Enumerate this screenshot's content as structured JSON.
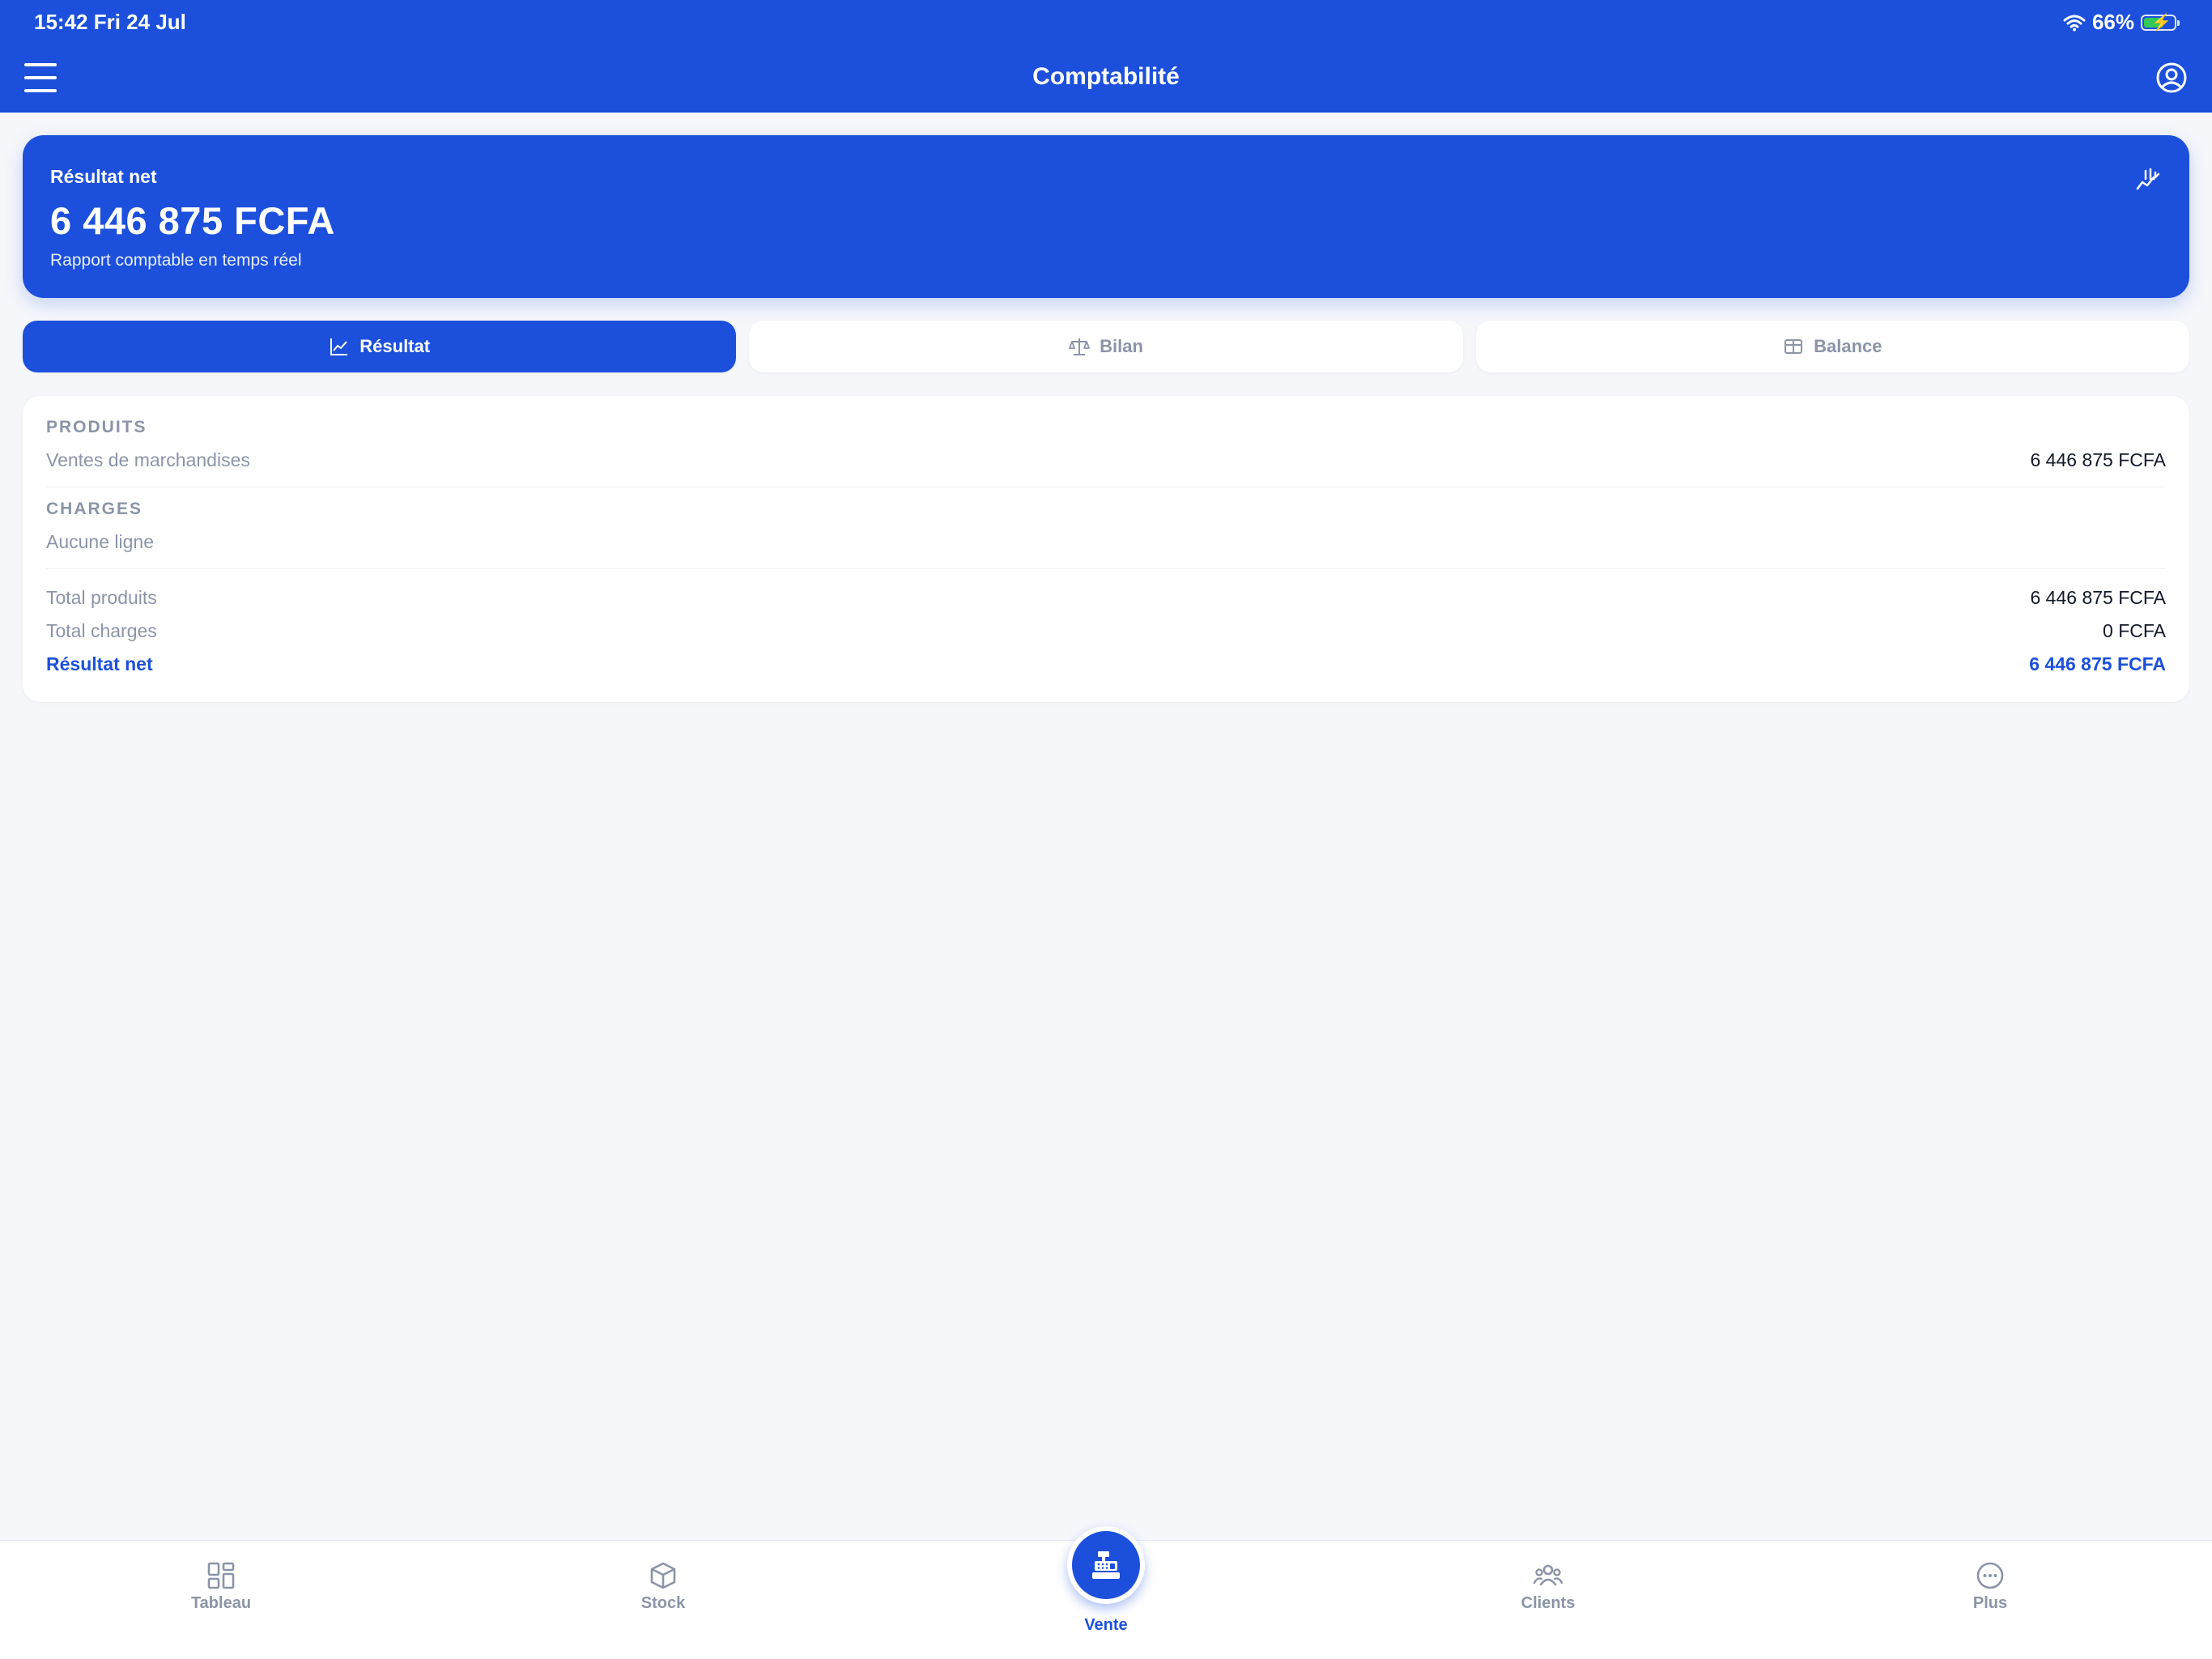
{
  "status_bar": {
    "time_date": "15:42  Fri 24 Jul",
    "battery": "66%"
  },
  "nav": {
    "title": "Comptabilité"
  },
  "hero": {
    "label": "Résultat net",
    "value": "6 446 875 FCFA",
    "subtitle": "Rapport comptable en temps réel"
  },
  "tabs": [
    {
      "label": "Résultat",
      "icon": "line-chart-icon",
      "active": true
    },
    {
      "label": "Bilan",
      "icon": "scale-icon",
      "active": false
    },
    {
      "label": "Balance",
      "icon": "table-icon",
      "active": false
    }
  ],
  "report": {
    "produits_heading": "PRODUITS",
    "produits_line_label": "Ventes de marchandises",
    "produits_line_value": "6 446 875 FCFA",
    "charges_heading": "CHARGES",
    "charges_empty": "Aucune ligne",
    "total_produits_label": "Total produits",
    "total_produits_value": "6 446 875 FCFA",
    "total_charges_label": "Total charges",
    "total_charges_value": "0 FCFA",
    "resultat_label": "Résultat net",
    "resultat_value": "6 446 875 FCFA"
  },
  "bottom_nav": [
    {
      "label": "Tableau",
      "icon": "dashboard-icon"
    },
    {
      "label": "Stock",
      "icon": "box-icon"
    },
    {
      "label": "Vente",
      "icon": "cash-register-icon",
      "active": true
    },
    {
      "label": "Clients",
      "icon": "users-icon"
    },
    {
      "label": "Plus",
      "icon": "more-icon"
    }
  ],
  "colors": {
    "primary": "#1c50dc",
    "background": "#f6f7fb",
    "muted": "#8b94a8"
  }
}
